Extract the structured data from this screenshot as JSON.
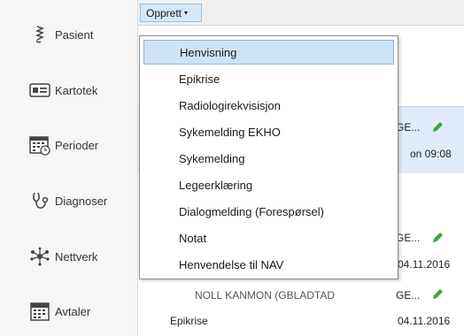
{
  "sidebar": {
    "items": [
      {
        "label": "Pasient",
        "icon": "patient-icon"
      },
      {
        "label": "Kartotek",
        "icon": "record-card-icon"
      },
      {
        "label": "Perioder",
        "icon": "calendar-clock-icon"
      },
      {
        "label": "Diagnoser",
        "icon": "stethoscope-icon"
      },
      {
        "label": "Nettverk",
        "icon": "network-icon"
      },
      {
        "label": "Avtaler",
        "icon": "calendar-icon"
      }
    ]
  },
  "toolbar": {
    "opprett_label": "Opprett",
    "opprett_caret": "▾"
  },
  "menu": {
    "items": [
      "Henvisning",
      "Epikrise",
      "Radiologirekvisisjon",
      "Sykemelding EKHO",
      "Sykemelding",
      "Legeerklæring",
      "Dialogmelding (Forespørsel)",
      "Notat",
      "Henvendelse til NAV"
    ],
    "active_index": 0
  },
  "list": {
    "rows": [
      {
        "title": "GE...",
        "date": "on 09:08",
        "selected": true
      },
      {
        "title": "GE...",
        "date": "04.11.2016",
        "selected": false
      },
      {
        "title": "GE...",
        "date": "",
        "selected": false
      }
    ],
    "bottom_row": {
      "type": "Epikrise",
      "date": "04.11.2016"
    },
    "clipped_title": "NOLL  KANMON  (GBLADTAD"
  },
  "colors": {
    "accent": "#cfe3f7",
    "pen_green": "#3fa535"
  }
}
